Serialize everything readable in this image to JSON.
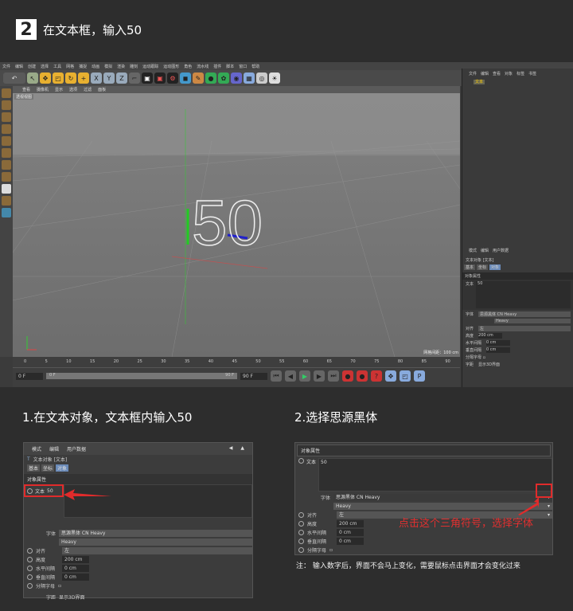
{
  "header": {
    "step": "2",
    "title": "在文本框，输入50"
  },
  "menu": [
    "文件",
    "编辑",
    "创建",
    "选择",
    "工具",
    "网格",
    "捕捉",
    "动画",
    "模拟",
    "渲染",
    "雕刻",
    "运动跟踪",
    "运动图形",
    "角色",
    "流水线",
    "插件",
    "脚本",
    "窗口",
    "帮助"
  ],
  "viewport": {
    "menu": [
      "查看",
      "摄像机",
      "显示",
      "选项",
      "过滤",
      "面板"
    ],
    "label": "透视视图",
    "grid_info": "网格间距：100 cm",
    "text_3d": "50"
  },
  "timeline": {
    "ticks": [
      "0",
      "5",
      "10",
      "15",
      "20",
      "25",
      "30",
      "35",
      "40",
      "45",
      "50",
      "55",
      "60",
      "65",
      "70",
      "75",
      "80",
      "85",
      "90"
    ],
    "start": "0 F",
    "end": "90 F",
    "current": "0 F",
    "range_end": "90 F"
  },
  "object_manager": {
    "tabs": [
      "文件",
      "编辑",
      "查看",
      "对象",
      "标签",
      "书签"
    ],
    "object": "文本"
  },
  "attributes": {
    "tabs": [
      "模式",
      "编辑",
      "用户数据"
    ],
    "title": "文本对象 [文本]",
    "subtabs": [
      "基本",
      "坐标",
      "对象"
    ],
    "section": "对象属性",
    "text_label": "文本",
    "text_value": "50",
    "font_label": "字体",
    "font_value": "思源黑体 CN Heavy",
    "font_weight": "Heavy",
    "align_label": "对齐",
    "align_value": "左",
    "height_label": "高度",
    "height_value": "200 cm",
    "hspace_label": "水平间隔",
    "hspace_value": "0 cm",
    "vspace_label": "垂直间隔",
    "vspace_value": "0 cm",
    "separate_label": "分隔字母",
    "glyph_label": "字距",
    "glyph_value": "显示3D界面"
  },
  "sections": {
    "left_title": "1.在文本对象，文本框内输入50",
    "right_title": "2.选择思源黑体"
  },
  "annotation": "点击这个三角符号，选择字体",
  "note": "注：  输入数字后，界面不会马上变化，需要鼠标点击界面才会变化过来"
}
